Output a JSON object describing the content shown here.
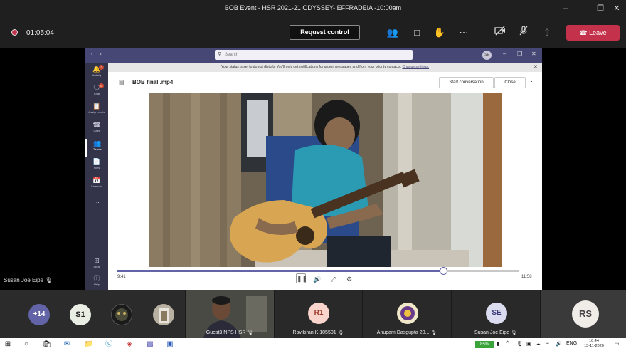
{
  "window": {
    "title": "BOB Event - HSR 2021-21 ODYSSEY- EFFRADEIA -10:00am"
  },
  "meeting": {
    "timer": "01:05:04",
    "request_control": "Request control",
    "leave_label": "Leave",
    "leave_color": "#c4314b",
    "icons": [
      "participants-icon",
      "chat-icon",
      "raise-hand-icon",
      "more-icon",
      "camera-off-icon",
      "mic-off-icon",
      "share-icon"
    ]
  },
  "teams": {
    "search_placeholder": "Search",
    "avatar_initials": "SE",
    "dnd_text": "Your status is set to do not disturb. You'll only get notifications for urgent messages and from your priority contacts.",
    "dnd_link": "Change settings.",
    "rail": [
      {
        "label": "Activity",
        "icon": "bell-icon",
        "badge": "2"
      },
      {
        "label": "Chat",
        "icon": "chat-icon",
        "badge": "6"
      },
      {
        "label": "Assignments",
        "icon": "assignments-icon",
        "badge": ""
      },
      {
        "label": "Calls",
        "icon": "phone-icon",
        "badge": ""
      },
      {
        "label": "Teams",
        "icon": "teams-icon",
        "badge": ""
      },
      {
        "label": "Files",
        "icon": "files-icon",
        "badge": ""
      },
      {
        "label": "Calendar",
        "icon": "calendar-icon",
        "badge": ""
      },
      {
        "label": "...",
        "icon": "more-icon",
        "badge": ""
      }
    ],
    "rail_bottom": [
      {
        "label": "Apps",
        "icon": "apps-icon"
      },
      {
        "label": "Help",
        "icon": "help-icon"
      }
    ],
    "file_name": "BOB final .mp4",
    "start_conversation": "Start conversation",
    "close": "Close",
    "player": {
      "current_time": "9:41",
      "total_time": "11:58",
      "progress": 0.81
    }
  },
  "speaker_name": "Susan Joe Eipe",
  "participants": {
    "overflow": "+14",
    "s1": "S1",
    "guest": "Guest3 NPS HSR",
    "r1_initials": "R1",
    "r1_name": "Ravikiran K 105501",
    "anupam_name": "Anupam Dasgupta 20...",
    "se_initials": "SE",
    "se_name": "Susan Joe Eipe",
    "rs_initials": "RS"
  },
  "taskbar": {
    "battery": "85%",
    "lang": "ENG",
    "time": "10:44",
    "date": "13-11-2020"
  }
}
